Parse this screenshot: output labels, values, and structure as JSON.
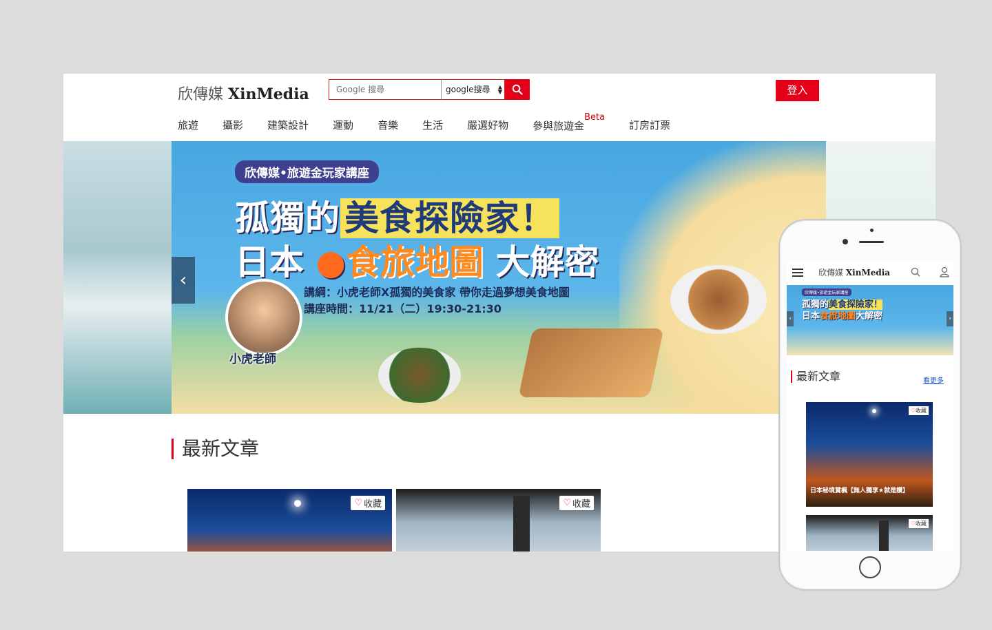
{
  "site": {
    "logo_cn": "欣傳媒",
    "logo_en": "XinMedia"
  },
  "search": {
    "placeholder": "Google 搜尋",
    "engine_selected": "google搜尋"
  },
  "login_label": "登入",
  "nav": [
    {
      "label": "旅遊"
    },
    {
      "label": "攝影"
    },
    {
      "label": "建築設計"
    },
    {
      "label": "運動"
    },
    {
      "label": "音樂"
    },
    {
      "label": "生活"
    },
    {
      "label": "嚴選好物"
    },
    {
      "label": "參與旅遊金",
      "badge": "Beta"
    },
    {
      "label": "訂房訂票"
    }
  ],
  "banner": {
    "tag": "欣傳媒•旅遊金玩家講座",
    "line1_prefix": "孤獨的",
    "line1_highlight": "美食探險家！",
    "line2_prefix": "日本",
    "line2_highlight": "食旅地圖",
    "line2_suffix": "大解密",
    "info_line1": "講綱：小虎老師X孤獨的美食家 帶你走過夢想美食地圖",
    "info_line2": "講座時間：11/21（二）19:30-21:30",
    "speaker": "小虎老師"
  },
  "hero_prev_label": "‹",
  "section_title": "最新文章",
  "fav_label": "收藏",
  "mobile": {
    "logo_cn": "欣傳媒",
    "logo_en": "XinMedia",
    "section_title": "最新文章",
    "more_label": "看更多",
    "card1_caption": "日本秘境賞楓【無人獨享★就是讚】",
    "fav_label": "收藏",
    "arrow_left": "‹",
    "arrow_right": "›"
  },
  "colors": {
    "brand_red": "#e5001a",
    "link_blue": "#1a56c2"
  }
}
